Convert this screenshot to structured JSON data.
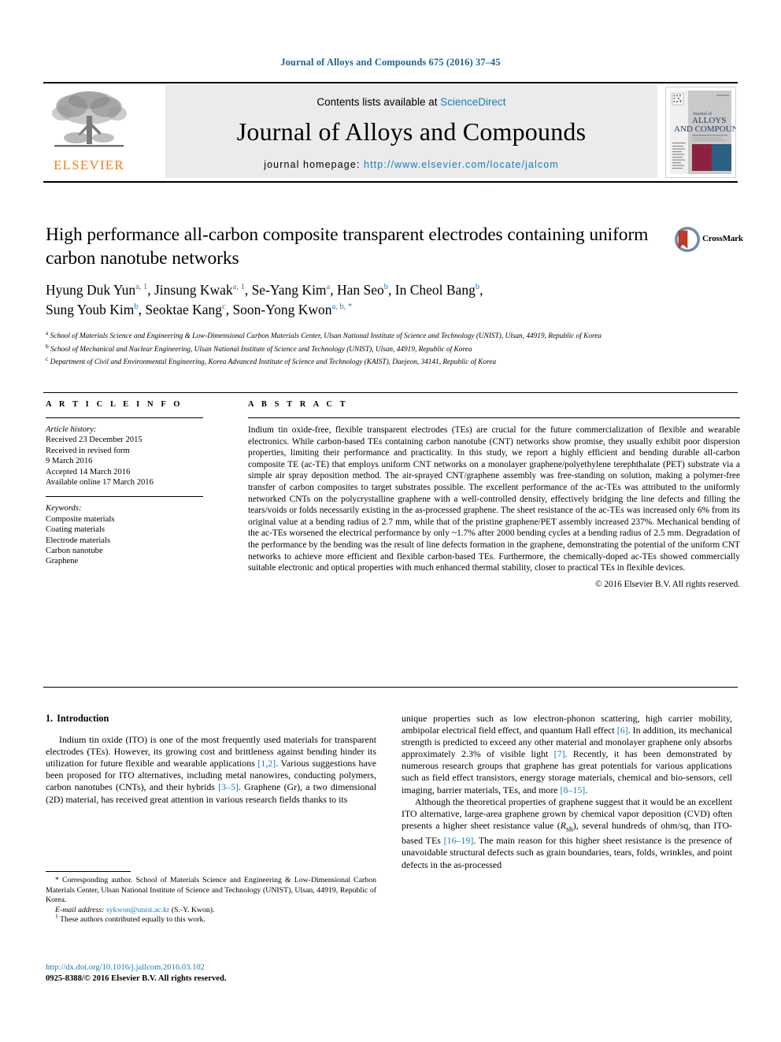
{
  "running_head": "Journal of Alloys and Compounds 675 (2016) 37–45",
  "masthead": {
    "contents_prefix": "Contents lists available at",
    "sciencedirect": "ScienceDirect",
    "journal_title": "Journal of Alloys and Compounds",
    "homepage_label": "journal homepage:",
    "homepage_url": "http://www.elsevier.com/locate/jalcom",
    "publisher_word": "ELSEVIER",
    "publisher_logo_icon": "elsevier-tree-icon",
    "cover_icon": "journal-cover-thumbnail",
    "cover_title_line1": "Journal of",
    "cover_title_line2": "ALLOYS",
    "cover_title_line3": "AND COMPOUNDS",
    "accent_blue": "#1a7cb8",
    "accent_orange": "#f07f1a",
    "band_gray": "#ebebeb"
  },
  "article": {
    "title": "High performance all-carbon composite transparent electrodes containing uniform carbon nanotube networks",
    "authors_line1": "Hyung Duk Yun",
    "authors_sup1": "a, 1",
    "authors_line1b": ", Jinsung Kwak",
    "authors_sup2": "a, 1",
    "authors_line1c": ", Se-Yang Kim",
    "authors_sup3": "a",
    "authors_line1d": ", Han Seo",
    "authors_sup4": "b",
    "authors_line1e": ", In Cheol Bang",
    "authors_sup5": "b",
    "authors_line1f": ",",
    "authors_line2a": "Sung Youb Kim",
    "authors_sup6": "b",
    "authors_line2b": ", Seoktae Kang",
    "authors_sup7": "c",
    "authors_line2c": ", Soon-Yong Kwon",
    "authors_sup8": "a, b, *",
    "affiliation_a_sup": "a",
    "affiliation_a": "School of Materials Science and Engineering & Low-Dimensional Carbon Materials Center, Ulsan National Institute of Science and Technology (UNIST), Ulsan, 44919, Republic of Korea",
    "affiliation_b_sup": "b",
    "affiliation_b": "School of Mechanical and Nuclear Engineering, Ulsan National Institute of Science and Technology (UNIST), Ulsan, 44919, Republic of Korea",
    "affiliation_c_sup": "c",
    "affiliation_c": "Department of Civil and Environmental Engineering, Korea Advanced Institute of Science and Technology (KAIST), Daejeon, 34141, Republic of Korea",
    "crossmark_label": "CrossMark",
    "crossmark_icon": "crossmark-icon"
  },
  "article_info": {
    "heading": "A R T I C L E  I N F O",
    "history_label": "Article history:",
    "history": [
      "Received 23 December 2015",
      "Received in revised form",
      "9 March 2016",
      "Accepted 14 March 2016",
      "Available online 17 March 2016"
    ],
    "keywords_label": "Keywords:",
    "keywords": [
      "Composite materials",
      "Coating materials",
      "Electrode materials",
      "Carbon nanotube",
      "Graphene"
    ]
  },
  "abstract": {
    "heading": "A B S T R A C T",
    "text": "Indium tin oxide-free, flexible transparent electrodes (TEs) are crucial for the future commercialization of flexible and wearable electronics. While carbon-based TEs containing carbon nanotube (CNT) networks show promise, they usually exhibit poor dispersion properties, limiting their performance and practicality. In this study, we report a highly efficient and bending durable all-carbon composite TE (ac-TE) that employs uniform CNT networks on a monolayer graphene/polyethylene terephthalate (PET) substrate via a simple air spray deposition method. The air-sprayed CNT/graphene assembly was free-standing on solution, making a polymer-free transfer of carbon composites to target substrates possible. The excellent performance of the ac-TEs was attributed to the uniformly networked CNTs on the polycrystalline graphene with a well-controlled density, effectively bridging the line defects and filling the tears/voids or folds necessarily existing in the as-processed graphene. The sheet resistance of the ac-TEs was increased only 6% from its original value at a bending radius of 2.7 mm, while that of the pristine graphene/PET assembly increased 237%. Mechanical bending of the ac-TEs worsened the electrical performance by only ~1.7% after 2000 bending cycles at a bending radius of 2.5 mm. Degradation of the performance by the bending was the result of line defects formation in the graphene, demonstrating the potential of the uniform CNT networks to achieve more efficient and flexible carbon-based TEs. Furthermore, the chemically-doped ac-TEs showed commercially suitable electronic and optical properties with much enhanced thermal stability, closer to practical TEs in flexible devices.",
    "copyright": "© 2016 Elsevier B.V. All rights reserved."
  },
  "introduction": {
    "number": "1.",
    "title": "Introduction",
    "left_p1_part1": "Indium tin oxide (ITO) is one of the most frequently used materials for transparent electrodes (TEs). However, its growing cost and brittleness against bending hinder its utilization for future flexible and wearable applications ",
    "left_p1_ref1": "[1,2]",
    "left_p1_part2": ". Various suggestions have been proposed for ITO alternatives, including metal nanowires, conducting polymers, carbon nanotubes (CNTs), and their hybrids ",
    "left_p1_ref2": "[3–5]",
    "left_p1_part3": ". Graphene (Gr), a two dimensional (2D) material, has received great attention in various research fields thanks to its",
    "right_p1_part1": "unique properties such as low electron-phonon scattering, high carrier mobility, ambipolar electrical field effect, and quantum Hall effect ",
    "right_p1_ref1": "[6]",
    "right_p1_part2": ". In addition, its mechanical strength is predicted to exceed any other material and monolayer graphene only absorbs approximately 2.3% of visible light ",
    "right_p1_ref2": "[7]",
    "right_p1_part3": ". Recently, it has been demonstrated by numerous research groups that graphene has great potentials for various applications such as field effect transistors, energy storage materials, chemical and bio-sensors, cell imaging, barrier materials, TEs, and more ",
    "right_p1_ref3": "[8–15]",
    "right_p1_part4": ".",
    "right_p2_part1": "Although the theoretical properties of graphene suggest that it would be an excellent ITO alternative, large-area graphene grown by chemical vapor deposition (CVD) often presents a higher sheet resistance value (",
    "right_p2_italic": "R",
    "right_p2_sub": "sh",
    "right_p2_part2": "), several hundreds of ohm/sq, than ITO-based TEs ",
    "right_p2_ref1": "[16–19]",
    "right_p2_part3": ". The main reason for this higher sheet resistance is the presence of unavoidable structural defects such as grain boundaries, tears, folds, wrinkles, and point defects in the as-processed"
  },
  "footnotes": {
    "corresponding_marker": "*",
    "corresponding_text": "Corresponding author. School of Materials Science and Engineering & Low-Dimensional Carbon Materials Center, Ulsan National Institute of Science and Technology (UNIST), Ulsan, 44919, Republic of Korea.",
    "email_label": "E-mail address:",
    "email": "sykwon@unist.ac.kr",
    "email_suffix": "(S.-Y. Kwon).",
    "equal_marker": "1",
    "equal_text": "These authors contributed equally to this work."
  },
  "doi_block": {
    "doi_url": "http://dx.doi.org/10.1016/j.jallcom.2016.03.102",
    "issn_line": "0925-8388/© 2016 Elsevier B.V. All rights reserved."
  }
}
